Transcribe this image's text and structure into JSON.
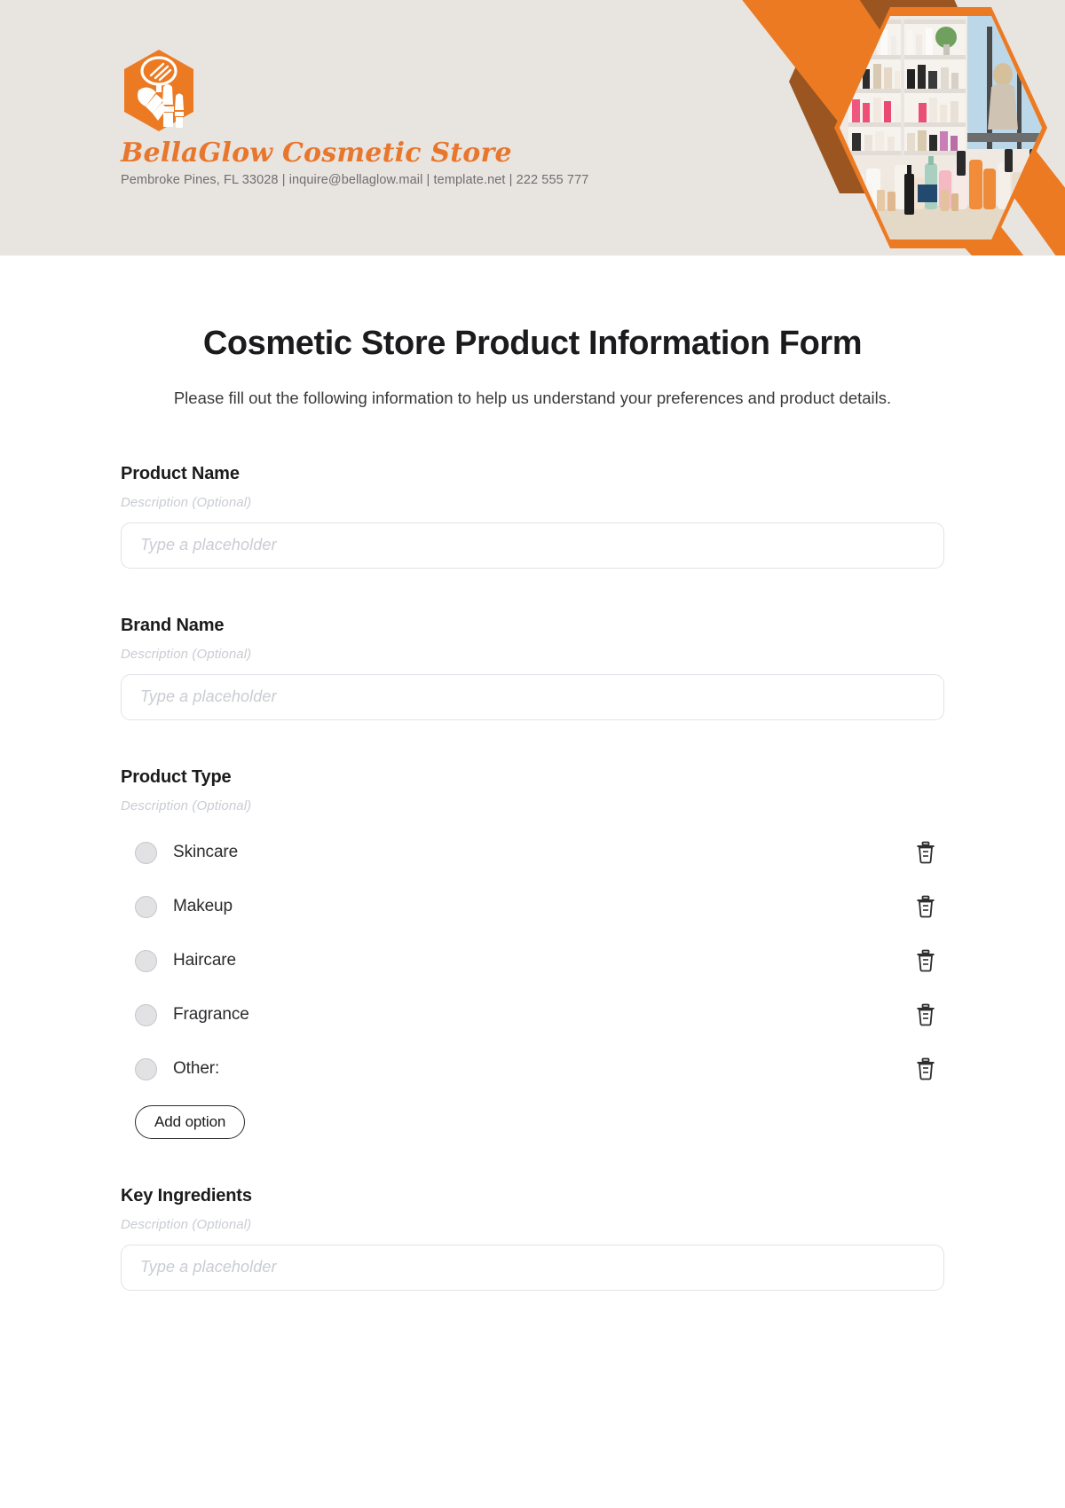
{
  "brand": {
    "logo_icon": "cosmetic-brushes-hexagon-logo",
    "name": "BellaGlow Cosmetic Store",
    "contact": "Pembroke Pines, FL 33028 | inquire@bellaglow.mail | template.net | 222 555 777",
    "accent_color": "#e8762c",
    "dark_accent_color": "#9b5520",
    "header_bg_color": "#e8e4e0",
    "header_image_alt": "cosmetic-store-shelves-photo"
  },
  "form": {
    "title": "Cosmetic Store Product Information Form",
    "subtitle": "Please fill out the following information to help us understand your preferences and product details.",
    "description_label": "Description (Optional)",
    "input_placeholder": "Type a placeholder",
    "add_option_label": "Add option",
    "fields": [
      {
        "label": "Product Name",
        "description": "Description (Optional)",
        "type": "text",
        "value": "",
        "placeholder": "Type a placeholder"
      },
      {
        "label": "Brand Name",
        "description": "Description (Optional)",
        "type": "text",
        "value": "",
        "placeholder": "Type a placeholder"
      },
      {
        "label": "Product Type",
        "description": "Description (Optional)",
        "type": "radio",
        "options": [
          {
            "label": "Skincare",
            "selected": false
          },
          {
            "label": "Makeup",
            "selected": false
          },
          {
            "label": "Haircare",
            "selected": false
          },
          {
            "label": "Fragrance",
            "selected": false
          },
          {
            "label": "Other:",
            "selected": false
          }
        ],
        "add_option_label": "Add option"
      },
      {
        "label": "Key Ingredients",
        "description": "Description (Optional)",
        "type": "text",
        "value": "",
        "placeholder": "Type a placeholder"
      }
    ]
  }
}
